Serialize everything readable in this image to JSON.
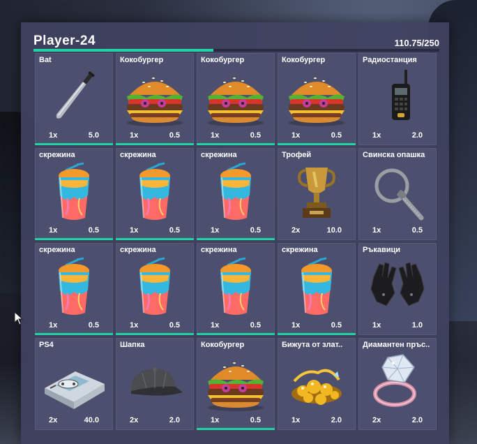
{
  "inventory": {
    "title": "Player-24",
    "weight_text": "110.75/250",
    "weight_fraction": 0.443,
    "accent_color": "#1fd3a5",
    "items": [
      {
        "name": "Bat",
        "qty": "1x",
        "weight": "5.0",
        "icon": "bat-icon",
        "bar": 1
      },
      {
        "name": "Кокобургер",
        "qty": "1x",
        "weight": "0.5",
        "icon": "burger-icon",
        "bar": 1
      },
      {
        "name": "Кокобургер",
        "qty": "1x",
        "weight": "0.5",
        "icon": "burger-icon",
        "bar": 1
      },
      {
        "name": "Кокобургер",
        "qty": "1x",
        "weight": "0.5",
        "icon": "burger-icon",
        "bar": 1
      },
      {
        "name": "Радиостанция",
        "qty": "1x",
        "weight": "2.0",
        "icon": "radio-icon",
        "bar": 0
      },
      {
        "name": "скрежина",
        "qty": "1x",
        "weight": "0.5",
        "icon": "slushie-icon",
        "bar": 1
      },
      {
        "name": "скрежина",
        "qty": "1x",
        "weight": "0.5",
        "icon": "slushie-icon",
        "bar": 1
      },
      {
        "name": "скрежина",
        "qty": "1x",
        "weight": "0.5",
        "icon": "slushie-icon",
        "bar": 1
      },
      {
        "name": "Трофей",
        "qty": "2x",
        "weight": "10.0",
        "icon": "trophy-icon",
        "bar": 0
      },
      {
        "name": "Свинска опашка",
        "qty": "1x",
        "weight": "0.5",
        "icon": "zip-tie-icon",
        "bar": 0
      },
      {
        "name": "скрежина",
        "qty": "1x",
        "weight": "0.5",
        "icon": "slushie-icon",
        "bar": 1
      },
      {
        "name": "скрежина",
        "qty": "1x",
        "weight": "0.5",
        "icon": "slushie-icon",
        "bar": 1
      },
      {
        "name": "скрежина",
        "qty": "1x",
        "weight": "0.5",
        "icon": "slushie-icon",
        "bar": 1
      },
      {
        "name": "скрежина",
        "qty": "1x",
        "weight": "0.5",
        "icon": "slushie-icon",
        "bar": 1
      },
      {
        "name": "Ръкавици",
        "qty": "1x",
        "weight": "1.0",
        "icon": "gloves-icon",
        "bar": 0
      },
      {
        "name": "PS4",
        "qty": "2x",
        "weight": "40.0",
        "icon": "console-icon",
        "bar": 0
      },
      {
        "name": "Шапка",
        "qty": "2x",
        "weight": "2.0",
        "icon": "cap-icon",
        "bar": 0
      },
      {
        "name": "Кокобургер",
        "qty": "1x",
        "weight": "0.5",
        "icon": "burger-icon",
        "bar": 1
      },
      {
        "name": "Бижута от злат..",
        "qty": "1x",
        "weight": "2.0",
        "icon": "gold-jewelry-icon",
        "bar": 0
      },
      {
        "name": "Диамантен пръс..",
        "qty": "2x",
        "weight": "2.0",
        "icon": "diamond-ring-icon",
        "bar": 0
      }
    ]
  }
}
